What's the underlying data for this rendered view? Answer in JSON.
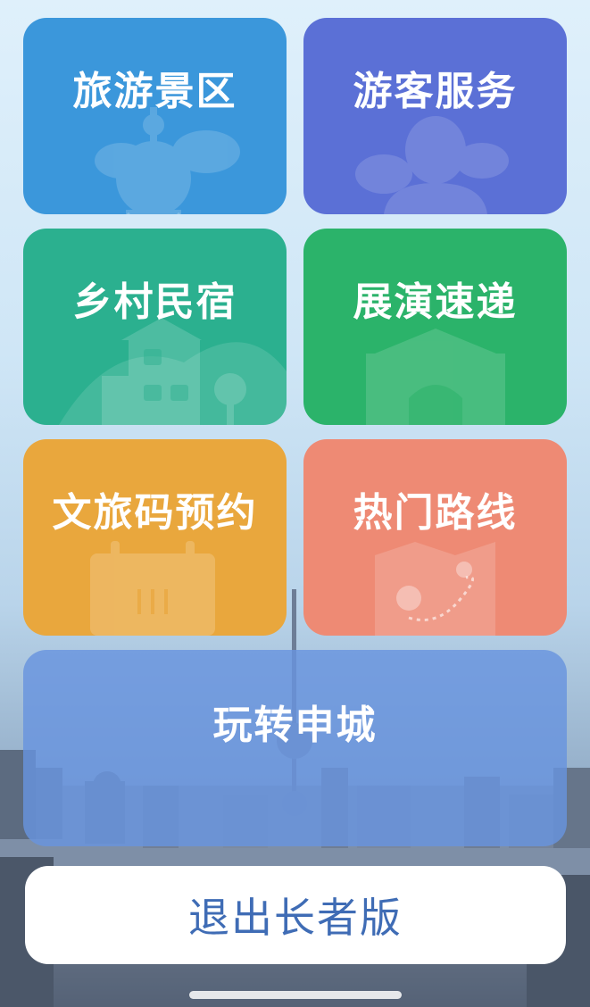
{
  "tiles": {
    "scenic": {
      "label": "旅游景区",
      "icon": "tv-tower-icon",
      "color": "#3b97db"
    },
    "visitor": {
      "label": "游客服务",
      "icon": "person-icon",
      "color": "#5b70d6"
    },
    "homestay": {
      "label": "乡村民宿",
      "icon": "house-icon",
      "color": "#2bb08f"
    },
    "expo": {
      "label": "展演速递",
      "icon": "gate-icon",
      "color": "#2bb36a"
    },
    "code": {
      "label": "文旅码预约",
      "icon": "calendar-icon",
      "color": "#e9a73d"
    },
    "routes": {
      "label": "热门路线",
      "icon": "map-route-icon",
      "color": "#ee8a74"
    },
    "city": {
      "label": "玩转申城",
      "icon": "",
      "color": "#6894de"
    }
  },
  "exit_button": {
    "label": "退出长者版",
    "color": "#3f6cb5"
  }
}
